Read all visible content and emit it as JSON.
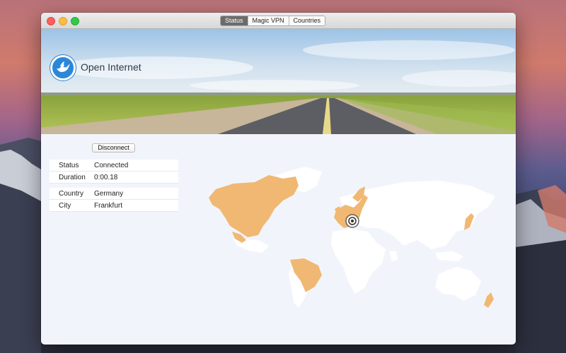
{
  "toolbar": {
    "tabs": [
      {
        "label": "Status",
        "active": true
      },
      {
        "label": "Magic VPN",
        "active": false
      },
      {
        "label": "Countries",
        "active": false
      }
    ]
  },
  "app": {
    "title": "Open Internet",
    "logo_icon": "dove-icon"
  },
  "actions": {
    "disconnect_label": "Disconnect"
  },
  "status": {
    "status_label": "Status",
    "status_value": "Connected",
    "duration_label": "Duration",
    "duration_value": "0:00.18"
  },
  "location": {
    "country_label": "Country",
    "country_value": "Germany",
    "city_label": "City",
    "city_value": "Frankfurt"
  },
  "map": {
    "available_color": "#f0b872",
    "land_color": "#ffffff",
    "marker_icon": "location-target-icon"
  },
  "colors": {
    "window_bg": "#f1f5fb",
    "active_tab": "#6b6b6b",
    "accent": "#2a87d9"
  }
}
